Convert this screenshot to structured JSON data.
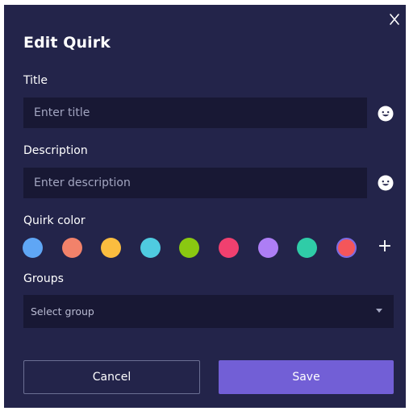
{
  "dialog": {
    "title": "Edit Quirk",
    "close_icon": "close-icon"
  },
  "fields": {
    "title": {
      "label": "Title",
      "value": "",
      "placeholder": "Enter title",
      "icon": "emoji-smile-icon"
    },
    "description": {
      "label": "Description",
      "value": "",
      "placeholder": "Enter description",
      "icon": "emoji-smile-icon"
    }
  },
  "quirk_color": {
    "label": "Quirk color",
    "swatches": [
      {
        "name": "blue",
        "color": "#5fa6f5"
      },
      {
        "name": "salmon",
        "color": "#f2826a"
      },
      {
        "name": "amber",
        "color": "#fbbd3f"
      },
      {
        "name": "cyan",
        "color": "#4fcbe0"
      },
      {
        "name": "lime",
        "color": "#8ac811"
      },
      {
        "name": "pink",
        "color": "#f0406f"
      },
      {
        "name": "lavender",
        "color": "#ad7ef5"
      },
      {
        "name": "teal",
        "color": "#2fcca7"
      },
      {
        "name": "red",
        "color": "#f4565a"
      }
    ],
    "selected_index": 8,
    "add_label": "+"
  },
  "groups": {
    "label": "Groups",
    "placeholder": "Select group"
  },
  "actions": {
    "cancel_label": "Cancel",
    "save_label": "Save"
  },
  "colors": {
    "dialog_bg": "#23244a",
    "input_bg": "#181834",
    "primary": "#725fd6",
    "text": "#ffffff",
    "muted_text": "#a3a6c1"
  }
}
